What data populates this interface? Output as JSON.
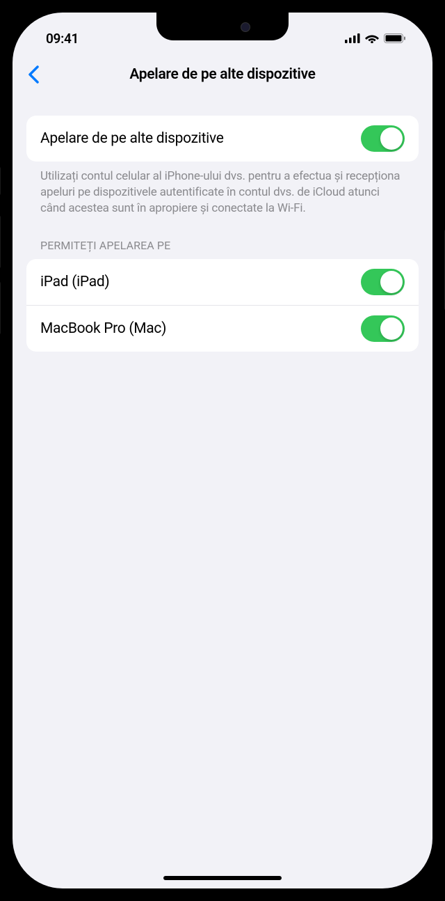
{
  "status": {
    "time": "09:41"
  },
  "nav": {
    "title": "Apelare de pe alte dispozitive"
  },
  "main_toggle": {
    "label": "Apelare de pe alte dispozitive",
    "enabled": true
  },
  "footer": "Utilizați contul celular al iPhone-ului dvs. pentru a efectua și recepționa apeluri pe dispozitivele autentificate în contul dvs. de iCloud atunci când acestea sunt în apropiere și conectate la Wi-Fi.",
  "devices_section": {
    "header": "PERMITEȚI APELAREA PE",
    "items": [
      {
        "label": "iPad (iPad)",
        "enabled": true
      },
      {
        "label": "MacBook Pro (Mac)",
        "enabled": true
      }
    ]
  },
  "colors": {
    "toggle_on": "#34c759",
    "link": "#007aff",
    "background": "#f2f2f7",
    "text_secondary": "#8a8a8e"
  }
}
